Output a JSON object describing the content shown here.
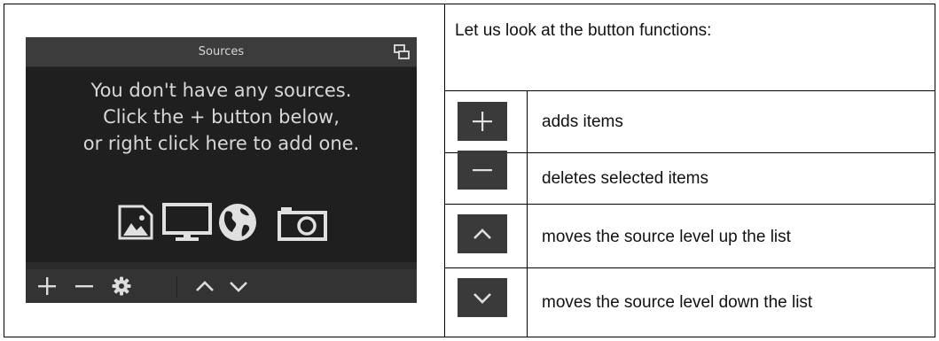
{
  "dock": {
    "title": "Sources",
    "empty_lines": [
      "You don't have any sources.",
      "Click the + button below,",
      "or right click here to add one."
    ],
    "source_type_icons": [
      "image-icon",
      "display-icon",
      "globe-icon",
      "camera-icon"
    ],
    "toolbar": [
      "add-icon",
      "remove-icon",
      "gear-icon",
      "chevron-up-icon",
      "chevron-down-icon"
    ]
  },
  "table": {
    "intro": "Let us look at the button functions:",
    "rows": [
      {
        "icon": "plus-icon",
        "text": "adds items"
      },
      {
        "icon": "minus-icon",
        "text": "deletes selected items"
      },
      {
        "icon": "chevron-up-icon",
        "text": "moves the source level up the list"
      },
      {
        "icon": "chevron-down-icon",
        "text": "moves the source level down the list"
      }
    ]
  },
  "colors": {
    "dock_bg": "#2b2b2b",
    "dock_title_bg": "#3c3c3c",
    "dock_text": "#d8d8d8",
    "button_bg": "#3a3a3a"
  }
}
